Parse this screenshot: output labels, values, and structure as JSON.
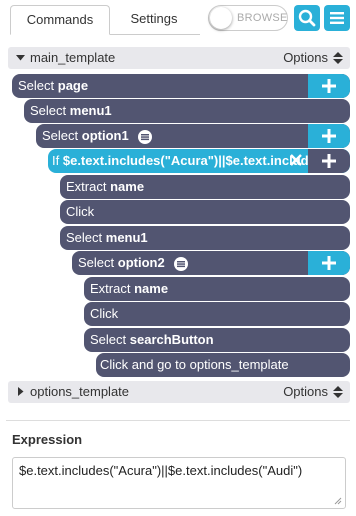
{
  "tabs": {
    "commands": "Commands",
    "settings": "Settings"
  },
  "toggle": {
    "label": "BROWSE"
  },
  "templates": {
    "main": {
      "name": "main_template",
      "options": "Options"
    },
    "options": {
      "name": "options_template",
      "options": "Options"
    }
  },
  "commands": [
    {
      "kw": "Select",
      "arg": "page"
    },
    {
      "kw": "Select",
      "arg": "menu1"
    },
    {
      "kw": "Select",
      "arg": "option1"
    },
    {
      "kw": "If",
      "arg": "$e.text.includes(\"Acura\")||$e.text.includes(\""
    },
    {
      "kw": "Extract",
      "arg": "name"
    },
    {
      "kw": "Click",
      "arg": ""
    },
    {
      "kw": "Select",
      "arg": "menu1"
    },
    {
      "kw": "Select",
      "arg": "option2"
    },
    {
      "kw": "Extract",
      "arg": "name"
    },
    {
      "kw": "Click",
      "arg": ""
    },
    {
      "kw": "Select",
      "arg": "searchButton"
    },
    {
      "kw": "Click and go to options_template",
      "arg": ""
    }
  ],
  "expression": {
    "title": "Expression",
    "value": "$e.text.includes(\"Acura\")||$e.text.includes(\"Audi\")"
  },
  "colors": {
    "accent": "#2ab0d8",
    "command_bg": "#525571",
    "template_bg": "#e8e8ec"
  }
}
